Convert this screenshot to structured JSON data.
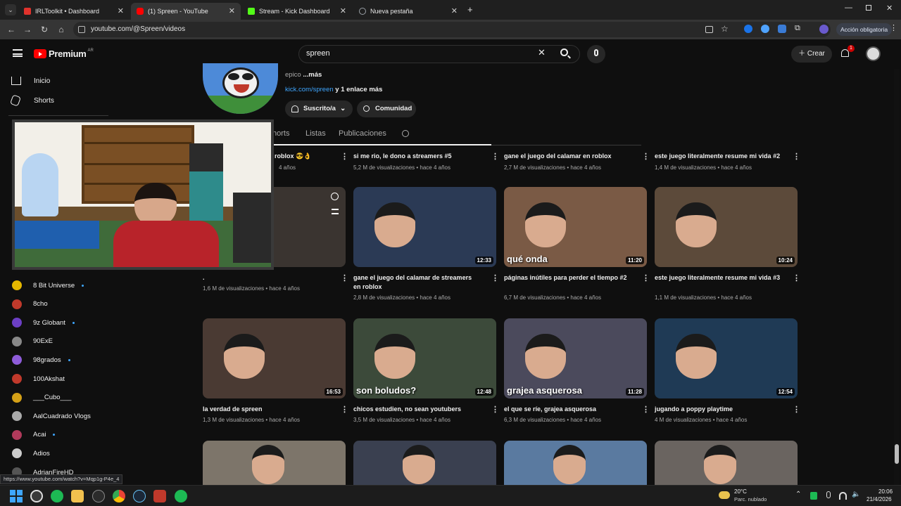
{
  "browser": {
    "tabs": [
      {
        "label": "IRLToolkit • Dashboard",
        "color": "#e0322c"
      },
      {
        "label": "(1) Spreen - YouTube",
        "color": "#ff0000"
      },
      {
        "label": "Stream - Kick Dashboard",
        "color": "#53fc18"
      },
      {
        "label": "Nueva pestaña",
        "color": "#9aa0a6"
      }
    ],
    "url": "youtube.com/@Spreen/videos",
    "accion_label": "Acción obligatoria"
  },
  "youtube": {
    "logo": "Premium",
    "logo_badge": "AR",
    "search_query": "spreen",
    "crear_label": "Crear",
    "notif_count": "1",
    "sidebar": {
      "inicio": "Inicio",
      "shorts": "Shorts"
    },
    "channels": [
      {
        "name": "8 Bit Universe",
        "color": "#e6b800",
        "dot": true
      },
      {
        "name": "8cho",
        "color": "#c0392b",
        "dot": false
      },
      {
        "name": "9z Globant",
        "color": "#6c3fc5",
        "dot": true
      },
      {
        "name": "90ExE",
        "color": "#888888",
        "dot": false
      },
      {
        "name": "98grados",
        "color": "#8e5cd9",
        "dot": true
      },
      {
        "name": "100Akshat",
        "color": "#c0392b",
        "dot": false
      },
      {
        "name": "___Cubo___",
        "color": "#d4a017",
        "dot": false
      },
      {
        "name": "AalCuadrado Vlogs",
        "color": "#aaaaaa",
        "dot": false
      },
      {
        "name": "Acai",
        "color": "#b03a5b",
        "dot": true
      },
      {
        "name": "Adios",
        "color": "#cccccc",
        "dot": false
      },
      {
        "name": "AdrianFireHD",
        "color": "#555555",
        "dot": false
      }
    ],
    "channel_header": {
      "desc": "epico",
      "more": "...más",
      "link": "kick.com/spreen",
      "link_extra": " y 1 enlace más",
      "subscribed": "Suscrito/a",
      "community": "Comunidad"
    },
    "channel_tabs": [
      "horts",
      "Listas",
      "Publicaciones"
    ],
    "row0": [
      {
        "title": "roblox 😎👌",
        "meta": "4 años"
      },
      {
        "title": "si me rio, le dono a streamers #5",
        "meta": "5,2 M de visualizaciones • hace 4 años"
      },
      {
        "title": "gane el juego del calamar en roblox",
        "meta": "2,7 M de visualizaciones • hace 4 años"
      },
      {
        "title": "este juego literalmente resume mi vida #2",
        "meta": "1,4 M de visualizaciones • hace 4 años"
      }
    ],
    "row1": [
      {
        "title": ".",
        "meta": "1,6 M de visualizaciones • hace 4 años",
        "duration": "",
        "color": "#3a3430"
      },
      {
        "title": "gane el juego del calamar de streamers en roblox",
        "meta": "2,8 M de visualizaciones • hace 4 años",
        "duration": "12:33",
        "color": "#2b3a55"
      },
      {
        "title": "páginas inútiles para perder el tiempo #2",
        "meta": "6,7 M de visualizaciones • hace 4 años",
        "duration": "11:20",
        "color": "#7a5a45",
        "overlay": "qué onda"
      },
      {
        "title": "este juego literalmente resume mi vida #3",
        "meta": "1,1 M de visualizaciones • hace 4 años",
        "duration": "10:24",
        "color": "#5c4a3a"
      }
    ],
    "row2": [
      {
        "title": "la verdad de spreen",
        "meta": "1,3 M de visualizaciones • hace 4 años",
        "duration": "16:53",
        "color": "#4a3a33"
      },
      {
        "title": "chicos estudien, no sean youtubers",
        "meta": "3,5 M de visualizaciones • hace 4 años",
        "duration": "12:48",
        "color": "#3c4a3a",
        "overlay": "son boludos?"
      },
      {
        "title": "el que se ríe, grajea asquerosa",
        "meta": "6,3 M de visualizaciones • hace 4 años",
        "duration": "11:28",
        "color": "#4b4a5c",
        "overlay": "grajea asquerosa"
      },
      {
        "title": "jugando a poppy playtime",
        "meta": "4 M de visualizaciones • hace 4 años",
        "duration": "12:54",
        "color": "#1f3a55"
      }
    ],
    "row3_colors": [
      "#7d756a",
      "#3a4050",
      "#5a7aa0",
      "#6a6460"
    ]
  },
  "status_url": "https://www.youtube.com/watch?v=Mqp1g-P4e_4",
  "taskbar": {
    "weather_temp": "20°C",
    "weather_desc": "Parc. nublado",
    "time": "20:06",
    "date": "21/4/2026"
  }
}
